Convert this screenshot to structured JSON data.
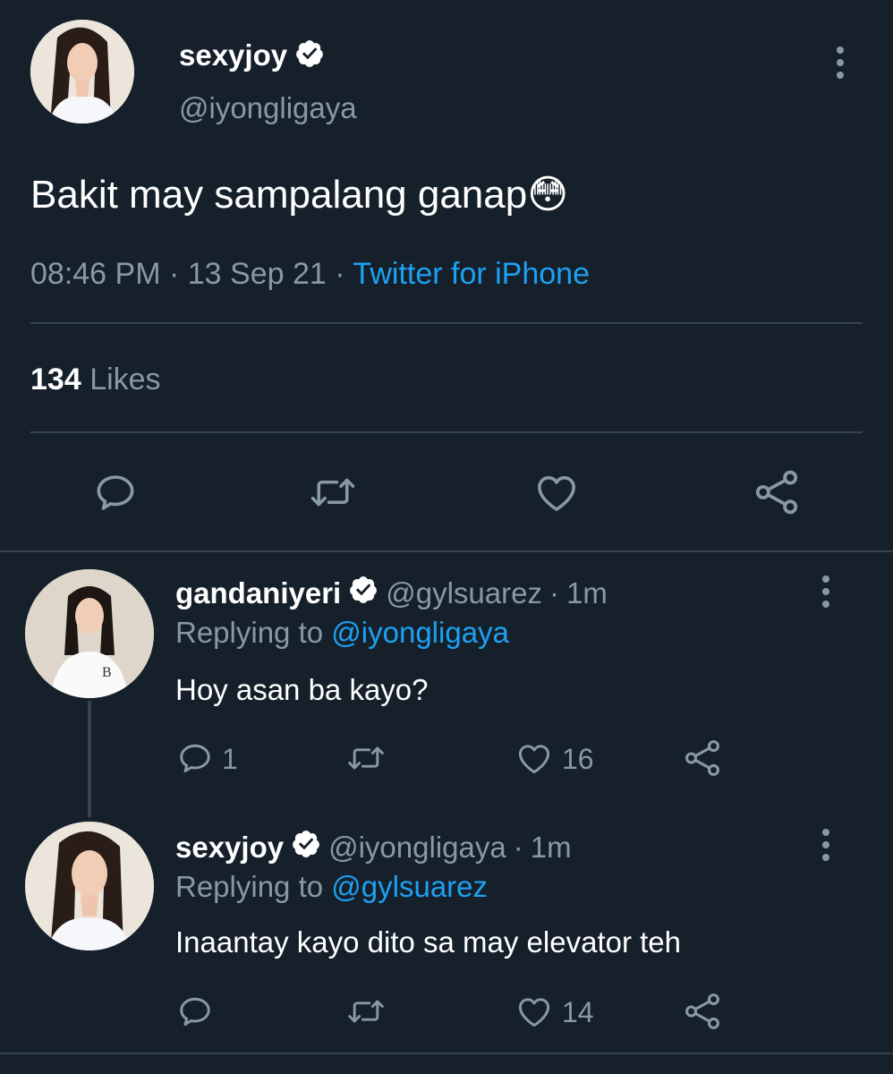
{
  "main_tweet": {
    "display_name": "sexyjoy",
    "handle": "@iyongligaya",
    "text": "Bakit may sampalang ganap",
    "emoji": "😳",
    "time": "08:46 PM",
    "date": "13 Sep 21",
    "source": "Twitter for iPhone",
    "separator": "·",
    "likes_count": "134",
    "likes_label": "Likes"
  },
  "replies": [
    {
      "display_name": "gandaniyeri",
      "handle": "@gylsuarez",
      "time": "1m",
      "separator": "·",
      "replying_prefix": "Replying to",
      "replying_to": "@iyongligaya",
      "text": "Hoy asan ba kayo?",
      "reply_count": "1",
      "like_count": "16"
    },
    {
      "display_name": "sexyjoy",
      "handle": "@iyongligaya",
      "time": "1m",
      "separator": "·",
      "replying_prefix": "Replying to",
      "replying_to": "@gylsuarez",
      "text": "Inaantay kayo dito sa may elevator teh",
      "reply_count": "",
      "like_count": "14"
    }
  ],
  "icons": {
    "reply": "reply-icon",
    "retweet": "retweet-icon",
    "like": "heart-icon",
    "share": "share-icon",
    "more": "more-options-icon",
    "verified": "verified-badge-icon"
  },
  "colors": {
    "background": "#15202b",
    "accent": "#1da1f2",
    "muted": "#8899a6",
    "divider": "#38444d"
  }
}
